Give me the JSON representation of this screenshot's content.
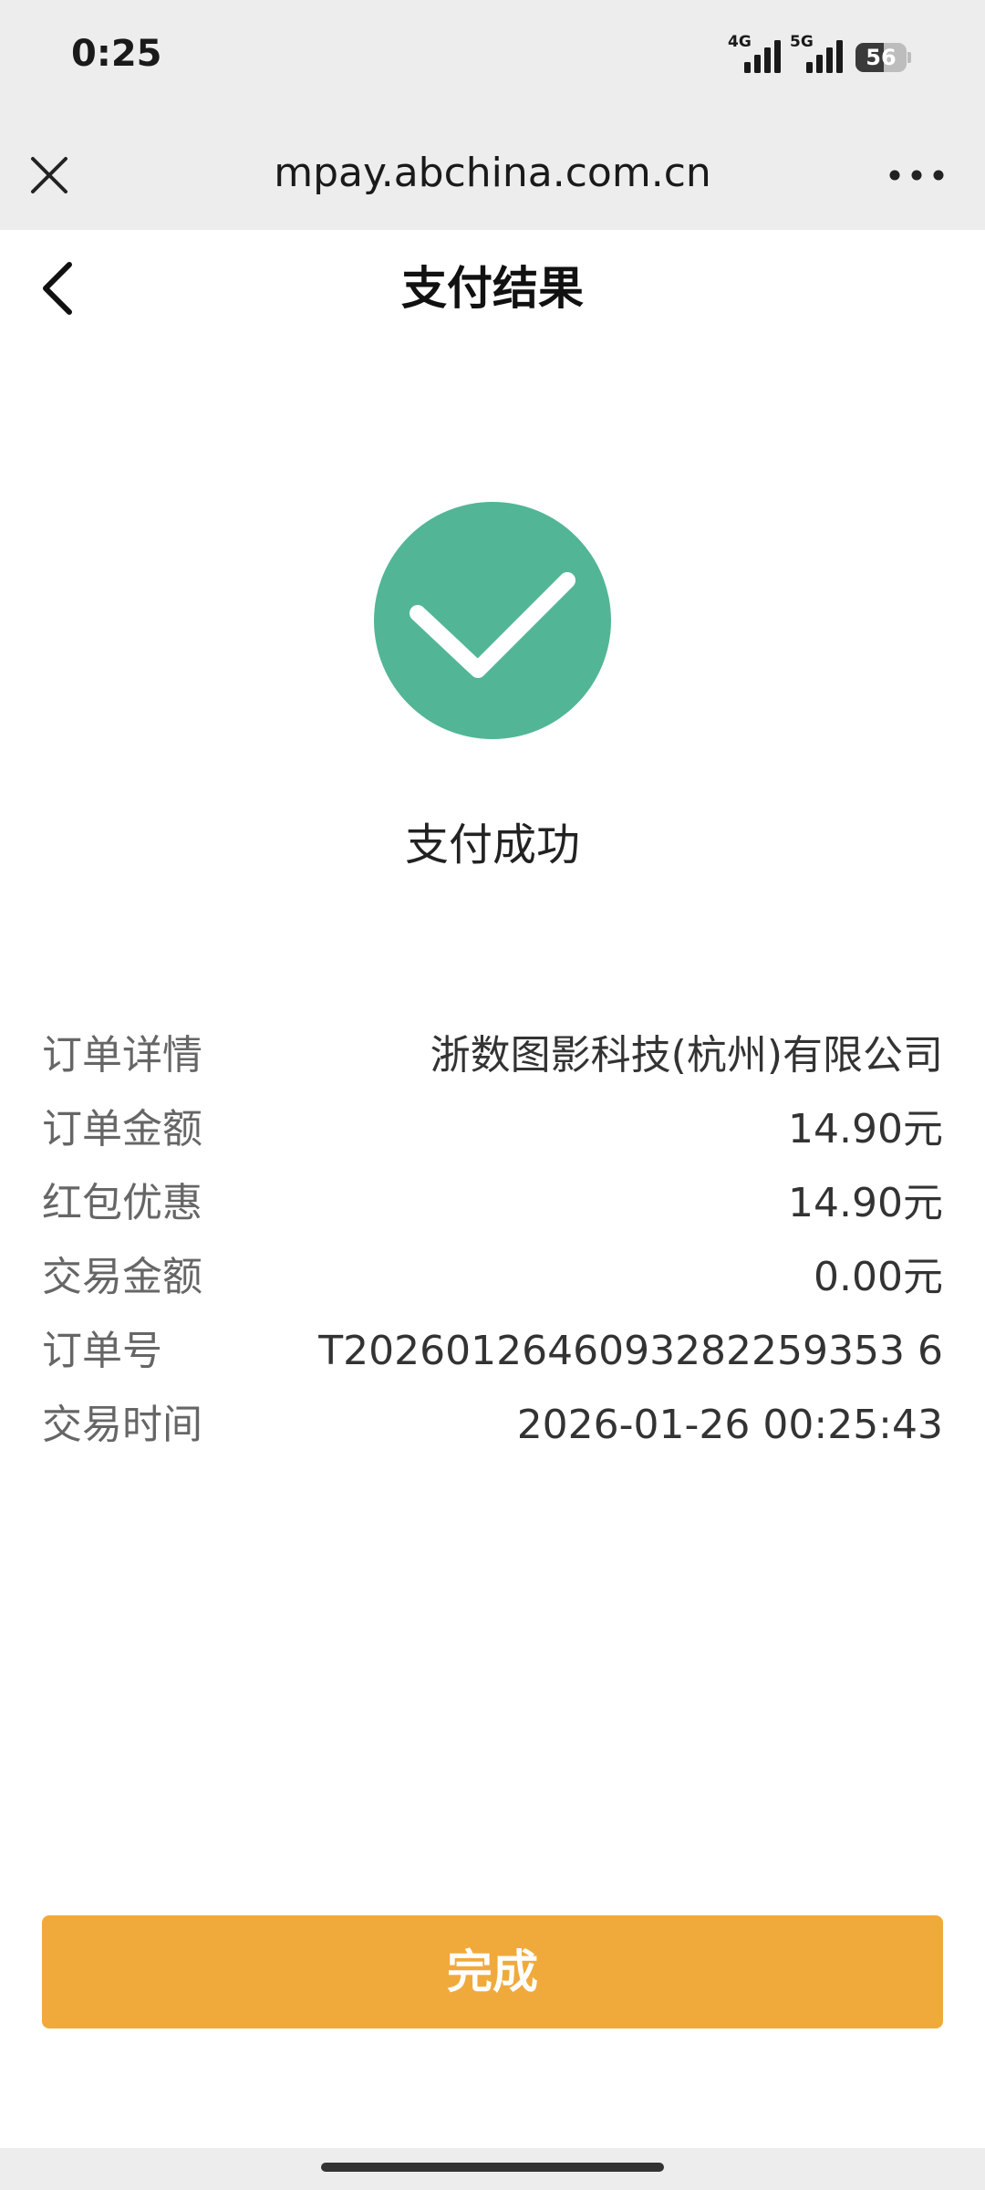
{
  "status_bar": {
    "time": "0:25",
    "signal_1_label": "4G",
    "signal_2_label": "5G",
    "battery_level": "56",
    "battery_fraction": 0.56
  },
  "browser": {
    "url": "mpay.abchina.com.cn",
    "close_icon": "close-icon",
    "more_icon": "more-dots-icon"
  },
  "header": {
    "title": "支付结果",
    "back_icon": "chevron-left-icon"
  },
  "result": {
    "icon": "check-circle-icon",
    "icon_color": "#52b696",
    "text": "支付成功"
  },
  "details": [
    {
      "label": "订单详情",
      "value": "浙数图影科技(杭州)有限公司"
    },
    {
      "label": "订单金额",
      "value": "14.90元"
    },
    {
      "label": "红包优惠",
      "value": "14.90元"
    },
    {
      "label": "交易金额",
      "value": "0.00元"
    },
    {
      "label": "订单号",
      "value": "T2026012646093282259353 6"
    },
    {
      "label": "交易时间",
      "value": "2026-01-26 00:25:43"
    }
  ],
  "done_button": {
    "label": "完成",
    "color": "#f0aa3c"
  }
}
